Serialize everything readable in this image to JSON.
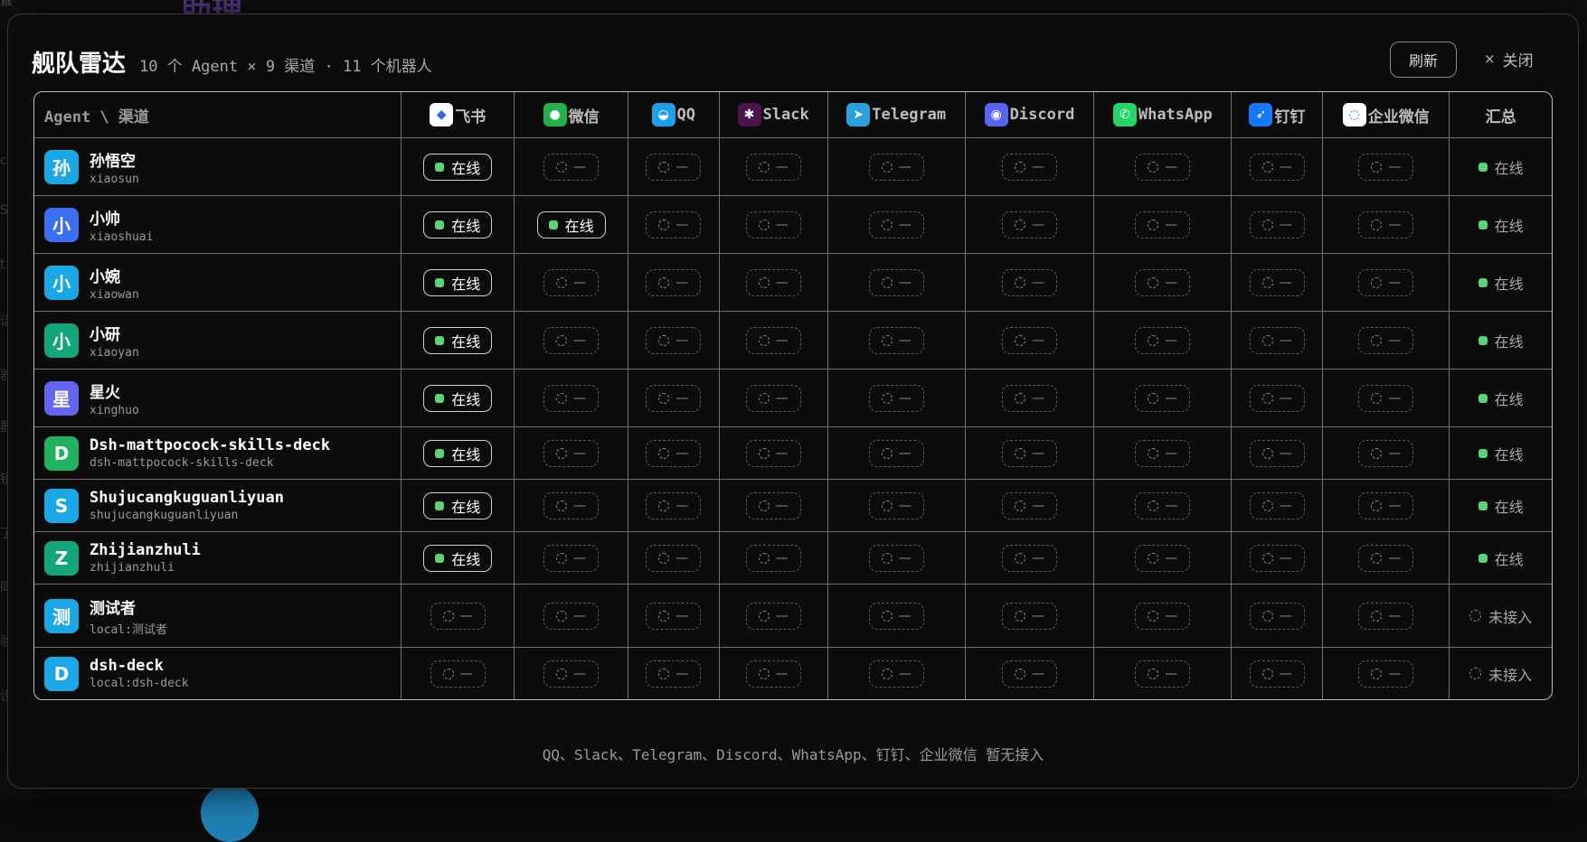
{
  "background": {
    "title": "助理",
    "side_letters": [
      "置",
      "c",
      "S",
      "t",
      "话",
      "器",
      "器",
      "锐",
      "了",
      "同",
      "验",
      "设"
    ]
  },
  "modal": {
    "title": "舰队雷达",
    "subtitle": "10 个 Agent × 9 渠道 · 11 个机器人",
    "refresh_label": "刷新",
    "close_label": "关闭",
    "close_icon": "×"
  },
  "table": {
    "corner_label": "Agent \\ 渠道",
    "summary_header": "汇总",
    "channels": [
      {
        "name": "飞书",
        "icon": "feishu-icon",
        "color": "#ffffff"
      },
      {
        "name": "微信",
        "icon": "wechat-icon",
        "color": "#22b14c"
      },
      {
        "name": "QQ",
        "icon": "qq-icon",
        "color": "#1ea0e8"
      },
      {
        "name": "Slack",
        "icon": "slack-icon",
        "color": "#4a154b"
      },
      {
        "name": "Telegram",
        "icon": "telegram-icon",
        "color": "#2aa1da"
      },
      {
        "name": "Discord",
        "icon": "discord-icon",
        "color": "#5865f2"
      },
      {
        "name": "WhatsApp",
        "icon": "whatsapp-icon",
        "color": "#25d366"
      },
      {
        "name": "钉钉",
        "icon": "dingtalk-icon",
        "color": "#1677ff"
      },
      {
        "name": "企业微信",
        "icon": "wecom-icon",
        "color": "#ffffff"
      }
    ],
    "online_label": "在线",
    "offline_label": "—",
    "agents": [
      {
        "avatar": "孙",
        "avatar_color": "#1aa7e6",
        "name": "孙悟空",
        "id": "xiaosun",
        "status": [
          1,
          0,
          0,
          0,
          0,
          0,
          0,
          0,
          0
        ],
        "summary": "在线",
        "summary_online": true
      },
      {
        "avatar": "小",
        "avatar_color": "#3b6ef0",
        "name": "小帅",
        "id": "xiaoshuai",
        "status": [
          1,
          1,
          0,
          0,
          0,
          0,
          0,
          0,
          0
        ],
        "summary": "在线",
        "summary_online": true
      },
      {
        "avatar": "小",
        "avatar_color": "#1aa7e6",
        "name": "小婉",
        "id": "xiaowan",
        "status": [
          1,
          0,
          0,
          0,
          0,
          0,
          0,
          0,
          0
        ],
        "summary": "在线",
        "summary_online": true
      },
      {
        "avatar": "小",
        "avatar_color": "#13a67a",
        "name": "小研",
        "id": "xiaoyan",
        "status": [
          1,
          0,
          0,
          0,
          0,
          0,
          0,
          0,
          0
        ],
        "summary": "在线",
        "summary_online": true
      },
      {
        "avatar": "星",
        "avatar_color": "#6366f1",
        "name": "星火",
        "id": "xinghuo",
        "status": [
          1,
          0,
          0,
          0,
          0,
          0,
          0,
          0,
          0
        ],
        "summary": "在线",
        "summary_online": true
      },
      {
        "avatar": "D",
        "avatar_color": "#1fb35e",
        "name": "Dsh-mattpocock-skills-deck",
        "id": "dsh-mattpocock-skills-deck",
        "status": [
          1,
          0,
          0,
          0,
          0,
          0,
          0,
          0,
          0
        ],
        "summary": "在线",
        "summary_online": true
      },
      {
        "avatar": "S",
        "avatar_color": "#1aa7e6",
        "name": "Shujucangkuguanliyuan",
        "id": "shujucangkuguanliyuan",
        "status": [
          1,
          0,
          0,
          0,
          0,
          0,
          0,
          0,
          0
        ],
        "summary": "在线",
        "summary_online": true
      },
      {
        "avatar": "Z",
        "avatar_color": "#13a67a",
        "name": "Zhijianzhuli",
        "id": "zhijianzhuli",
        "status": [
          1,
          0,
          0,
          0,
          0,
          0,
          0,
          0,
          0
        ],
        "summary": "在线",
        "summary_online": true
      },
      {
        "avatar": "测",
        "avatar_color": "#1aa7e6",
        "name": "测试者",
        "id": "local:测试者",
        "status": [
          0,
          0,
          0,
          0,
          0,
          0,
          0,
          0,
          0
        ],
        "summary": "未接入",
        "summary_online": false
      },
      {
        "avatar": "D",
        "avatar_color": "#1aa7e6",
        "name": "dsh-deck",
        "id": "local:dsh-deck",
        "status": [
          0,
          0,
          0,
          0,
          0,
          0,
          0,
          0,
          0
        ],
        "summary": "未接入",
        "summary_online": false
      }
    ]
  },
  "footer_note": "QQ、Slack、Telegram、Discord、WhatsApp、钉钉、企业微信 暂无接入"
}
